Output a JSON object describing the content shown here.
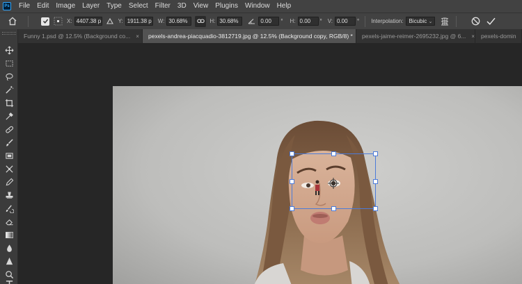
{
  "menu": {
    "logo": "Ps",
    "items": [
      "File",
      "Edit",
      "Image",
      "Layer",
      "Type",
      "Select",
      "Filter",
      "3D",
      "View",
      "Plugins",
      "Window",
      "Help"
    ]
  },
  "options": {
    "x_label": "X:",
    "x_value": "4407.38 p",
    "y_label": "Y:",
    "y_value": "1911.38 p",
    "w_label": "W:",
    "w_value": "30.68%",
    "h_label": "H:",
    "h_value": "30.68%",
    "angle_value": "0.00",
    "angle_unit": "°",
    "hskew_label": "H:",
    "hskew_value": "0.00",
    "hskew_unit": "°",
    "vskew_label": "V:",
    "vskew_value": "0.00",
    "vskew_unit": "°",
    "interp_label": "Interpolation:",
    "interp_value": "Bicubic"
  },
  "tabs": [
    {
      "label": "Funny 1.psd @ 12.5% (Background co...",
      "close": "×"
    },
    {
      "label": "pexels-andrea-piacquadio-3812719.jpg @ 12.5% (Background copy, RGB/8) *",
      "close": "×"
    },
    {
      "label": "pexels-jaime-reimer-2695232.jpg @ 6...",
      "close": "×"
    },
    {
      "label": "pexels-domin",
      "close": ""
    }
  ],
  "tools": [
    "move-tool",
    "marquee-tool",
    "lasso-tool",
    "magic-wand-tool",
    "crop-tool",
    "eyedropper-tool",
    "healing-brush-tool",
    "brush-tool",
    "frame-tool",
    "puppet-warp-tool",
    "pen-tool",
    "clone-stamp-tool",
    "history-brush-tool",
    "eraser-tool",
    "gradient-tool",
    "blur-tool",
    "dodge-tool",
    "zoom-tool",
    "type-tool"
  ],
  "colors": {
    "app_bg": "#262626",
    "bar_bg": "#424242",
    "accent": "#31a8ff",
    "selection": "#4c7bd9"
  }
}
